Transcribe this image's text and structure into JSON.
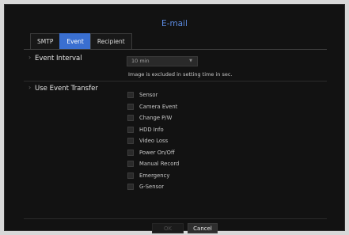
{
  "dialog": {
    "title": "E-mail"
  },
  "tabs": [
    {
      "label": "SMTP",
      "active": false
    },
    {
      "label": "Event",
      "active": true
    },
    {
      "label": "Recipient",
      "active": false
    }
  ],
  "event_interval": {
    "label": "Event Interval",
    "selected": "10 min",
    "note": "Image is excluded in setting time in sec."
  },
  "event_transfer": {
    "label": "Use Event Transfer",
    "items": [
      {
        "label": "Sensor",
        "checked": false
      },
      {
        "label": "Camera Event",
        "checked": false
      },
      {
        "label": "Change P/W",
        "checked": false
      },
      {
        "label": "HDD Info",
        "checked": false
      },
      {
        "label": "Video Loss",
        "checked": false
      },
      {
        "label": "Power On/Off",
        "checked": false
      },
      {
        "label": "Manual Record",
        "checked": false
      },
      {
        "label": "Emergency",
        "checked": false
      },
      {
        "label": "G-Sensor",
        "checked": false
      }
    ]
  },
  "buttons": {
    "ok": "OK",
    "cancel": "Cancel"
  },
  "colors": {
    "accent": "#3a6fd0",
    "title": "#5b8ae0",
    "background": "#121212"
  }
}
